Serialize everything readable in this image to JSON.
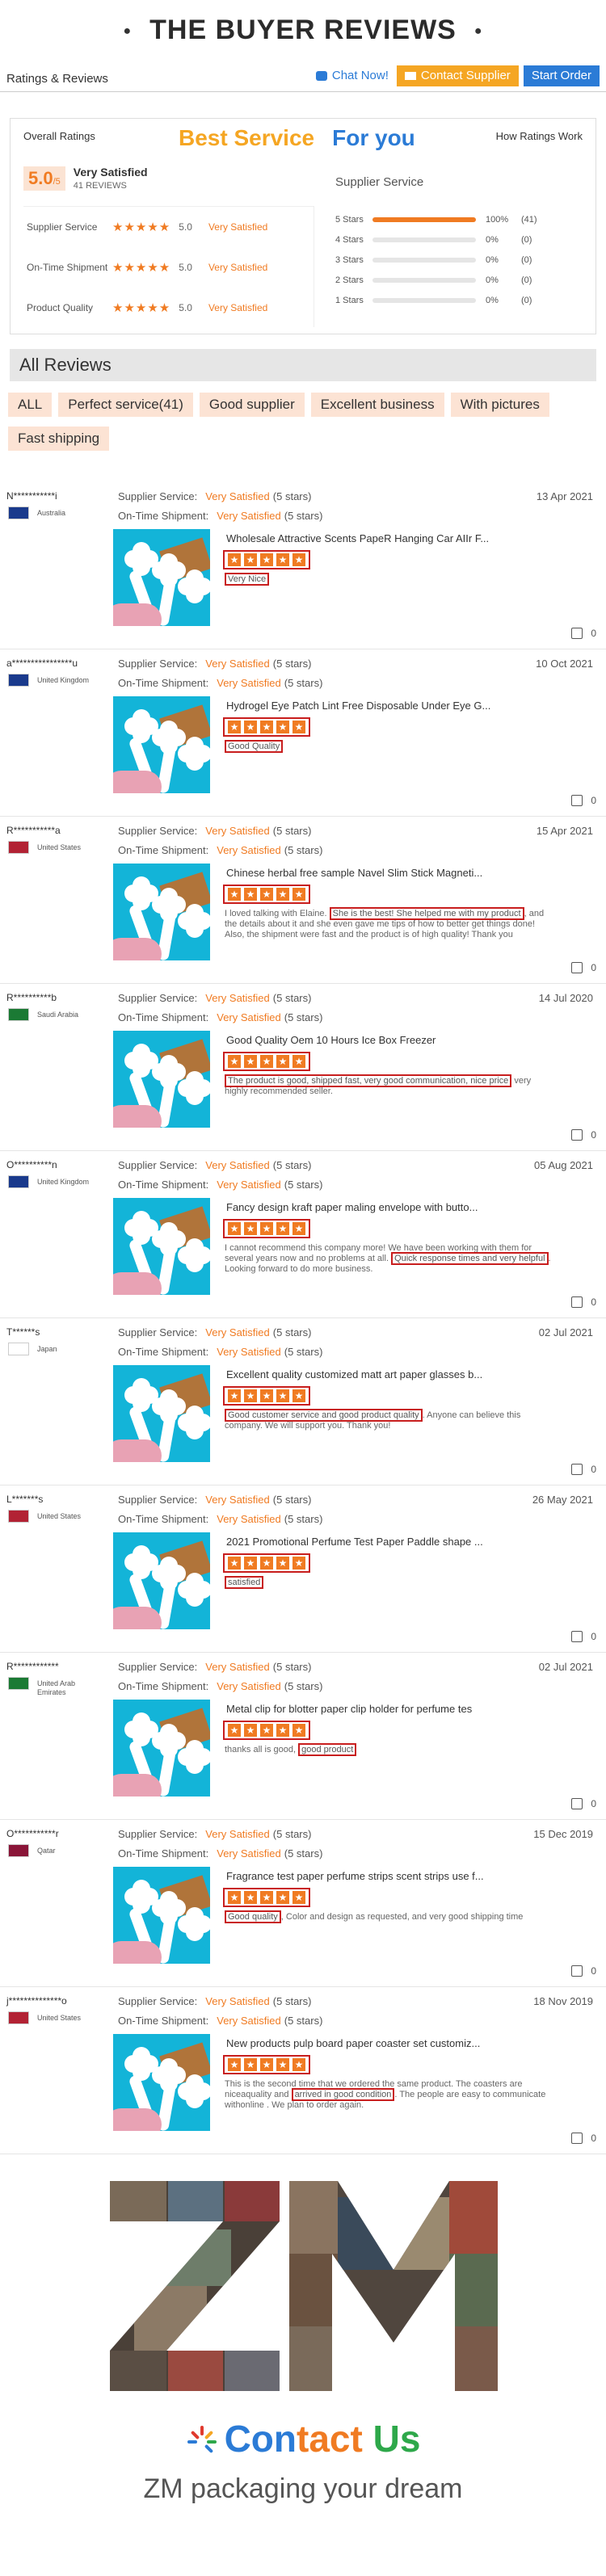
{
  "header": {
    "title": "THE BUYER REVIEWS",
    "bullet": "●"
  },
  "topbar": {
    "label": "Ratings & Reviews",
    "chat": "Chat Now!",
    "contact": "Contact Supplier",
    "order": "Start Order"
  },
  "ratings": {
    "overall_label": "Overall Ratings",
    "best": "Best Service",
    "foryou": "For you",
    "how": "How Ratings Work",
    "score": "5.0",
    "score_max": "/5",
    "verdict": "Very Satisfied",
    "count": "41 REVIEWS",
    "sub": [
      {
        "name": "Supplier Service",
        "value": "5.0",
        "text": "Very Satisfied"
      },
      {
        "name": "On-Time Shipment",
        "value": "5.0",
        "text": "Very Satisfied"
      },
      {
        "name": "Product Quality",
        "value": "5.0",
        "text": "Very Satisfied"
      }
    ],
    "supplier_service_label": "Supplier Service",
    "distribution": [
      {
        "label": "5 Stars",
        "pct": "100%",
        "fraction": 1.0,
        "count": "(41)"
      },
      {
        "label": "4 Stars",
        "pct": "0%",
        "fraction": 0,
        "count": "(0)"
      },
      {
        "label": "3 Stars",
        "pct": "0%",
        "fraction": 0,
        "count": "(0)"
      },
      {
        "label": "2 Stars",
        "pct": "0%",
        "fraction": 0,
        "count": "(0)"
      },
      {
        "label": "1 Stars",
        "pct": "0%",
        "fraction": 0,
        "count": "(0)"
      }
    ]
  },
  "reviews_section": {
    "title": "All Reviews",
    "tags": [
      "ALL",
      "Perfect  service(41)",
      "Good supplier",
      "Excellent business",
      "With pictures",
      "Fast shipping"
    ]
  },
  "review_labels": {
    "supplier_service": "Supplier Service:",
    "on_time": "On-Time Shipment:",
    "verdict": "Very Satisfied",
    "stars": "(5 stars)"
  },
  "reviews": [
    {
      "name": "N***********i",
      "country": "Australia",
      "date": "13 Apr 2021",
      "product": "Wholesale Attractive Scents PapeR Hanging Car AIIr F...",
      "pre": "",
      "hl": "Very Nice",
      "post": "",
      "likes": "0",
      "flag": "#1a3a8c"
    },
    {
      "name": "a****************u",
      "country": "United Kingdom",
      "date": "10 Oct 2021",
      "product": "Hydrogel Eye Patch Lint Free Disposable Under Eye G...",
      "pre": "",
      "hl": "Good Quality",
      "post": "",
      "likes": "0",
      "flag": "#1a3a8c"
    },
    {
      "name": "R***********a",
      "country": "United States",
      "date": "15 Apr 2021",
      "product": "Chinese herbal free sample Navel Slim Stick Magneti...",
      "pre": "I loved talking with Elaine. ",
      "hl": "She is the best! She helped me with my product",
      "post": ", and the details about it and she even gave me tips of how to better get things done! Also, the shipment were fast and the product is of high quality! Thank you",
      "likes": "0",
      "flag": "#b22234"
    },
    {
      "name": "R**********b",
      "country": "Saudi Arabia",
      "date": "14 Jul 2020",
      "product": "Good Quality Oem 10 Hours Ice Box Freezer",
      "pre": "",
      "hl": "The product is good, shipped fast, very good communication, nice price",
      "post": " very highly recommended seller.",
      "likes": "0",
      "flag": "#1b7a34"
    },
    {
      "name": "O**********n",
      "country": "United Kingdom",
      "date": "05 Aug 2021",
      "product": "Fancy design kraft paper maling envelope with butto...",
      "pre": "I cannot recommend this company more! We have been working with them for several years now and no problems at all. ",
      "hl": "Quick response times and very helpful",
      "post": ". Looking forward to do more business.",
      "likes": "0",
      "flag": "#1a3a8c"
    },
    {
      "name": "T******s",
      "country": "Japan",
      "date": "02 Jul 2021",
      "product": "Excellent quality customized matt art paper glasses b...",
      "pre": "",
      "hl": "Good customer service and good product quality",
      "post": ". Anyone can believe this company. We will support you. Thank you!",
      "likes": "0",
      "flag": "#ffffff"
    },
    {
      "name": "L*******s",
      "country": "United States",
      "date": "26 May 2021",
      "product": "2021 Promotional Perfume Test Paper Paddle shape ...",
      "pre": "",
      "hl": "satisfied",
      "post": "",
      "likes": "0",
      "flag": "#b22234"
    },
    {
      "name": "R************",
      "country": "United Arab Emirates",
      "date": "02 Jul 2021",
      "product": "Metal clip for blotter paper clip holder for perfume tes",
      "pre": "thanks all is good, ",
      "hl": "good product",
      "post": "",
      "likes": "0",
      "flag": "#1b7a34"
    },
    {
      "name": "O***********r",
      "country": "Qatar",
      "date": "15 Dec 2019",
      "product": "Fragrance test paper perfume strips scent strips use f...",
      "pre": "",
      "hl": "Good quality",
      "post": ", Color and design as requested, and very good shipping time",
      "likes": "0",
      "flag": "#8a1538"
    },
    {
      "name": "j**************o",
      "country": "United States",
      "date": "18 Nov 2019",
      "product": "New products pulp board paper coaster set customiz...",
      "pre": "This is the second time that we ordered the same product. The coasters are niceaquality and ",
      "hl": "arrived in good condition",
      "post": ". The people are easy to communicate withonline . We plan to order again.",
      "likes": "0",
      "flag": "#b22234"
    }
  ],
  "footer": {
    "brand_letters": "ZM",
    "contact_1": "Con",
    "contact_2": "tact ",
    "contact_3": "Us",
    "tagline": "ZM packaging your dream"
  }
}
